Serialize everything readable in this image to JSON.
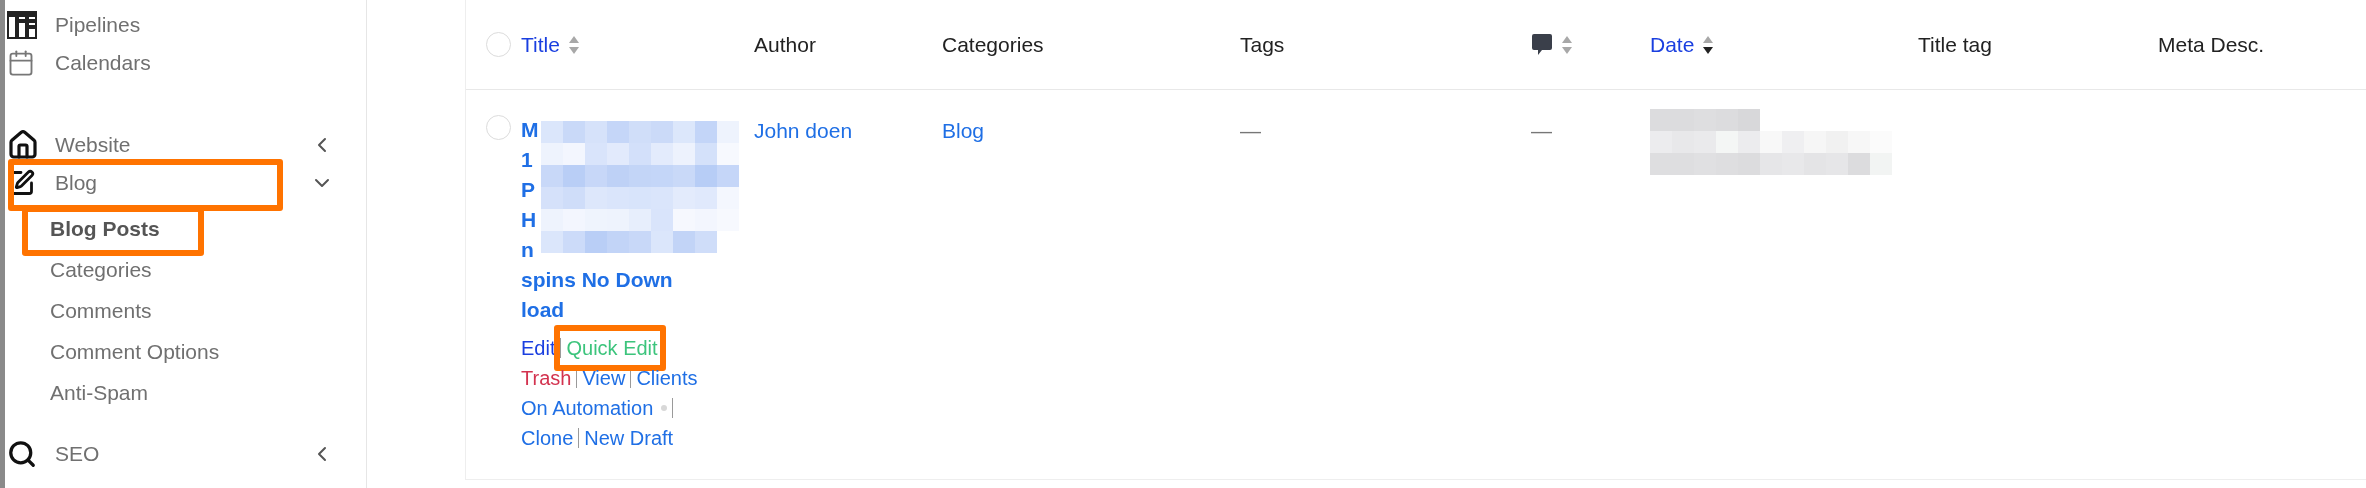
{
  "sidebar": {
    "items": [
      {
        "label": "Pipelines",
        "highlighted": false
      },
      {
        "label": "Calendars",
        "highlighted": false
      },
      {
        "label": "Website",
        "expanded": false,
        "highlighted": false
      },
      {
        "label": "Blog",
        "expanded": true,
        "highlighted": true,
        "children": [
          {
            "label": "Blog Posts",
            "selected": true,
            "highlighted": true
          },
          {
            "label": "Categories",
            "selected": false,
            "highlighted": false
          },
          {
            "label": "Comments",
            "selected": false,
            "highlighted": false
          },
          {
            "label": "Comment Options",
            "selected": false,
            "highlighted": false
          },
          {
            "label": "Anti-Spam",
            "selected": false,
            "highlighted": false
          }
        ]
      },
      {
        "label": "SEO",
        "expanded": false,
        "highlighted": false
      }
    ]
  },
  "table": {
    "columns": [
      {
        "kind": "text",
        "label": "Title",
        "link": true,
        "sortable": true,
        "sorted_descending": false
      },
      {
        "kind": "text",
        "label": "Author",
        "link": false,
        "sortable": false
      },
      {
        "kind": "text",
        "label": "Categories",
        "link": false,
        "sortable": false
      },
      {
        "kind": "text",
        "label": "Tags",
        "link": false,
        "sortable": false
      },
      {
        "kind": "icon",
        "sortable": true,
        "sorted_descending": false
      },
      {
        "kind": "text",
        "label": "Date",
        "link": true,
        "sortable": true,
        "sorted_descending": true
      },
      {
        "kind": "text",
        "label": "Title tag",
        "link": false,
        "sortable": false
      },
      {
        "kind": "text",
        "label": "Meta Desc.",
        "link": false,
        "sortable": false
      }
    ],
    "select_all": {
      "checked": false
    },
    "rows": [
      {
        "checked": false,
        "title_lines": [
          "M",
          "1",
          "P",
          "H",
          "n",
          "spins No Down",
          "load"
        ],
        "author": "John doen",
        "categories": "Blog",
        "tags": "—",
        "comments": "—",
        "action_lines": [
          [
            {
              "label": "Edit",
              "kind": "edit",
              "separator": true
            },
            {
              "label": "Quick Edit",
              "kind": "quick",
              "separator": true,
              "highlighted": true
            }
          ],
          [
            {
              "label": "Trash",
              "kind": "trash",
              "separator": true
            },
            {
              "label": "View",
              "kind": "link",
              "separator": true
            },
            {
              "label": "Clients",
              "kind": "link",
              "separator": false
            }
          ],
          [
            {
              "label": "On Automation",
              "kind": "link",
              "dot": true,
              "separator": true
            }
          ],
          [
            {
              "label": "Clone",
              "kind": "link",
              "separator": true
            },
            {
              "label": "New Draft",
              "kind": "link",
              "separator": false
            }
          ]
        ]
      }
    ]
  }
}
